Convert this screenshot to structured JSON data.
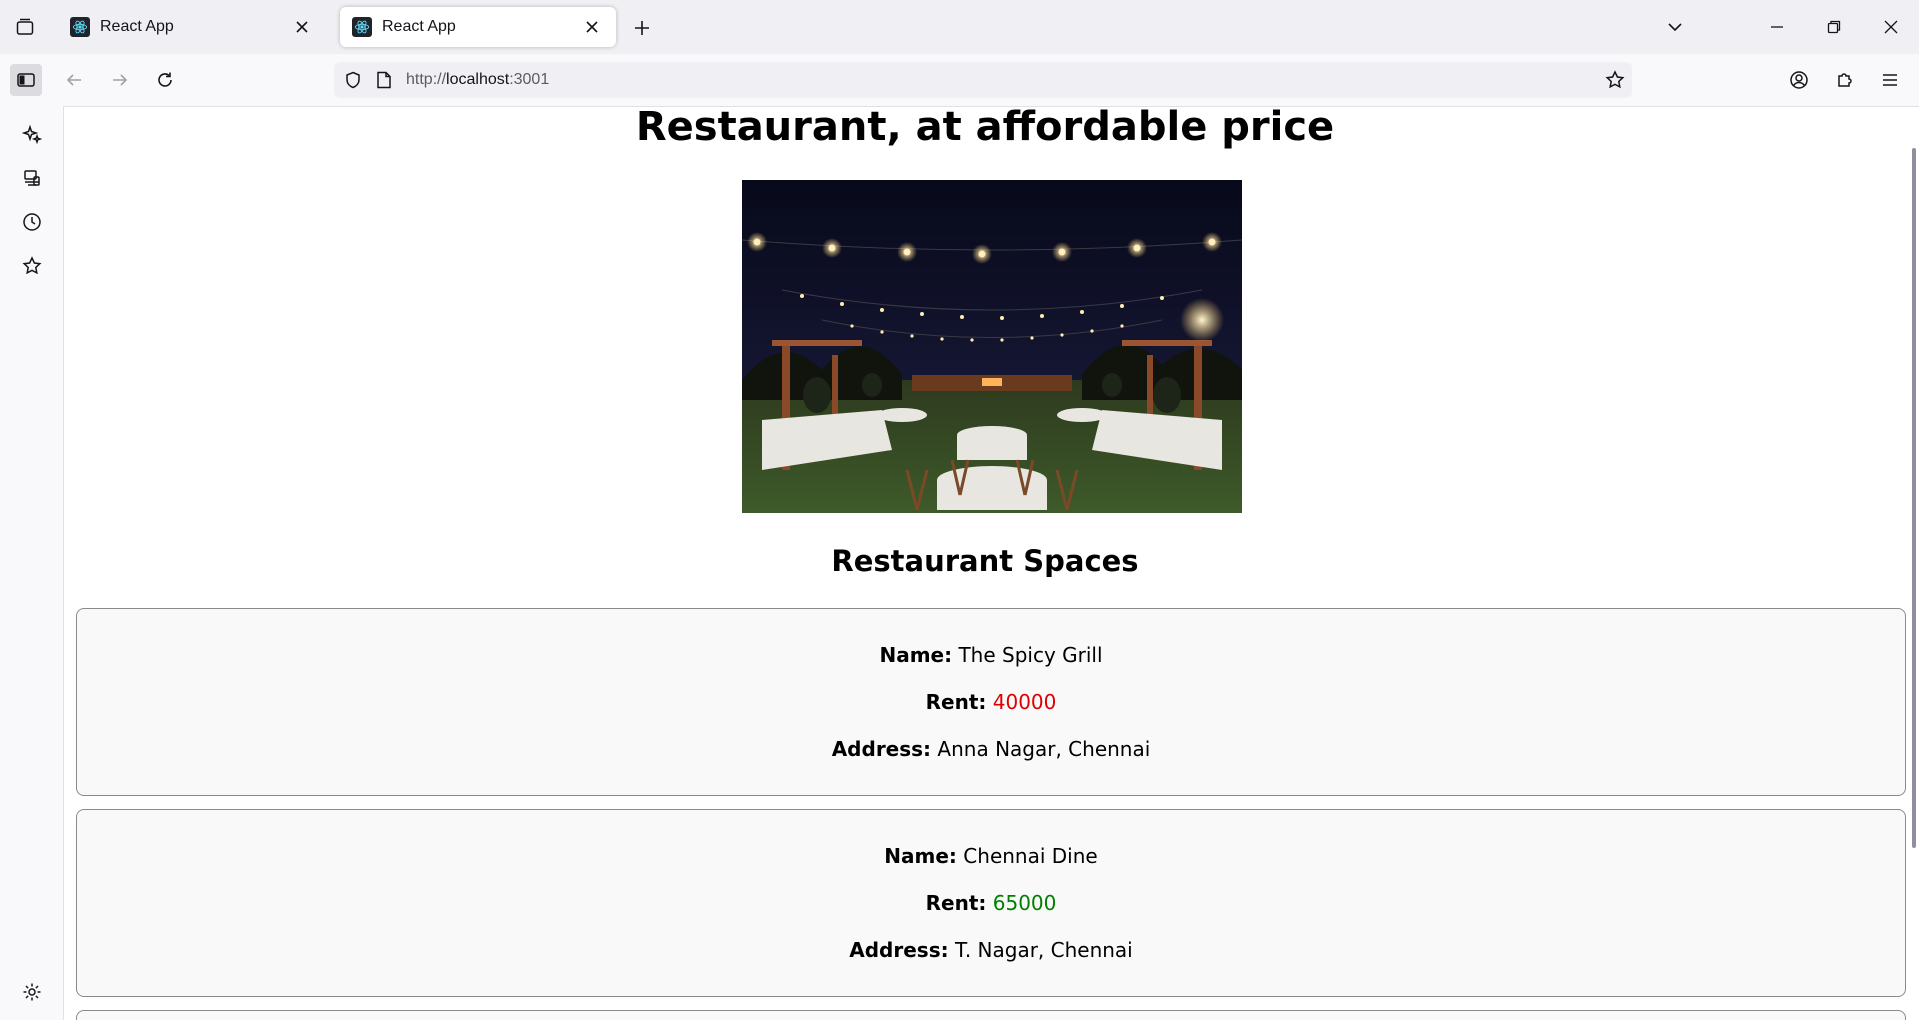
{
  "browser": {
    "tabs": [
      {
        "title": "React App",
        "active": false
      },
      {
        "title": "React App",
        "active": true
      }
    ],
    "url": {
      "scheme": "http://",
      "host": "localhost",
      "port": ":3001"
    }
  },
  "page": {
    "heading": "Restaurant, at affordable price",
    "section_heading": "Restaurant Spaces",
    "labels": {
      "name": "Name:",
      "rent": "Rent:",
      "address": "Address:"
    },
    "restaurants": [
      {
        "name": "The Spicy Grill",
        "rent": "40000",
        "rent_color": "#e00000",
        "address": "Anna Nagar, Chennai"
      },
      {
        "name": "Chennai Dine",
        "rent": "65000",
        "rent_color": "#008000",
        "address": "T. Nagar, Chennai"
      }
    ]
  },
  "icons": {
    "tabstrip": [
      "tab-list-icon",
      "react-favicon-icon",
      "close-icon",
      "plus-icon",
      "chevron-down-icon",
      "minimize-icon",
      "restore-icon",
      "close-window-icon"
    ],
    "toolbar": [
      "sidebar-icon",
      "back-arrow-icon",
      "forward-arrow-icon",
      "reload-icon",
      "shield-icon",
      "page-icon",
      "star-icon",
      "account-icon",
      "extensions-icon",
      "menu-icon"
    ],
    "sidebar": [
      "ai-sparkle-icon",
      "synced-tabs-icon",
      "history-icon",
      "bookmarks-star-icon",
      "settings-gear-icon"
    ]
  }
}
